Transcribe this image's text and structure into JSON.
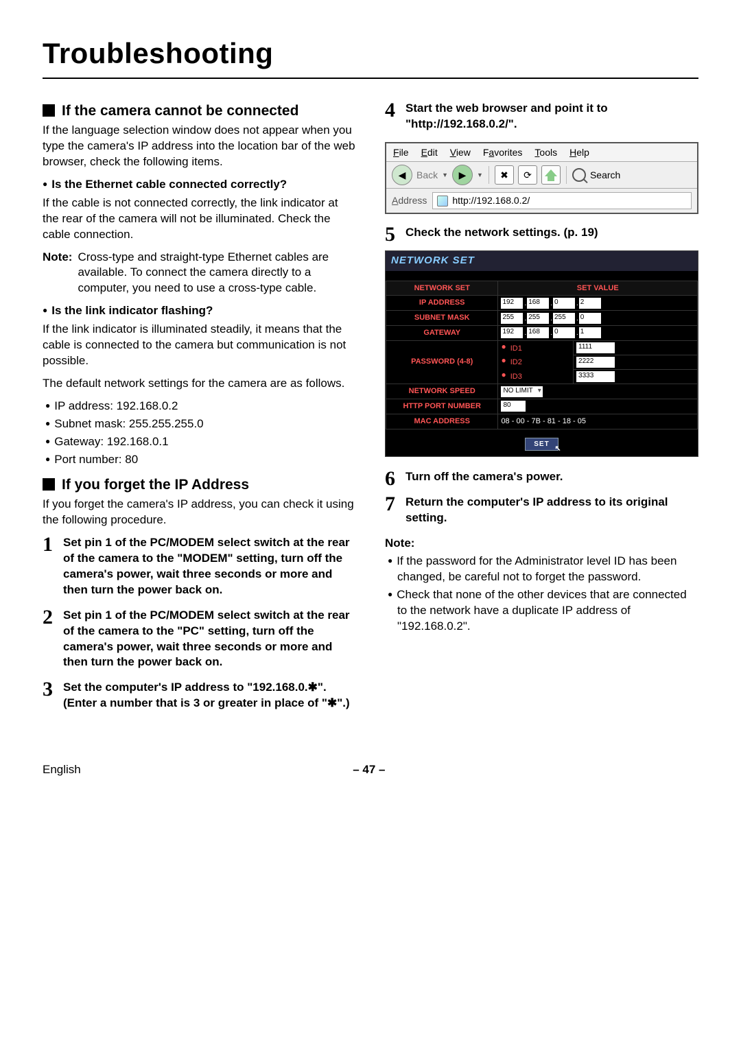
{
  "page_title": "Troubleshooting",
  "left": {
    "sec1_title": "If the camera cannot be connected",
    "sec1_p1": "If the language selection window does not appear when you type the camera's IP address into the location bar of the web browser, check the following items.",
    "sub1": "Is the Ethernet cable connected correctly?",
    "sub1_p": "If the cable is not connected correctly, the link indicator at the rear of the camera will not be illuminated. Check the cable connection.",
    "note1_lbl": "Note:",
    "note1_body": "Cross-type and straight-type Ethernet cables are available. To connect the camera directly to a computer, you need to use a cross-type cable.",
    "sub2": "Is the link indicator flashing?",
    "sub2_p1": "If the link indicator is illuminated steadily, it means that the cable is connected to the camera but communication is not possible.",
    "sub2_p2": "The default network settings for the camera are as follows.",
    "defaults": [
      "IP address: 192.168.0.2",
      "Subnet mask: 255.255.255.0",
      "Gateway: 192.168.0.1",
      "Port number: 80"
    ],
    "sec2_title": "If you forget the IP Address",
    "sec2_p1": "If you forget the camera's IP address, you can check it using the following procedure.",
    "step1": "Set pin 1 of the PC/MODEM select switch at the rear of the camera to the \"MODEM\" setting, turn off the camera's power, wait three seconds or more and then turn the power back on.",
    "step2": "Set pin 1 of the PC/MODEM select switch at the rear of the camera to the \"PC\" setting, turn off the camera's power, wait three seconds or more and then turn the power back on.",
    "step3": "Set the computer's IP address to \"192.168.0.✱\". (Enter a number that is 3 or greater in place of \"✱\".)"
  },
  "right": {
    "step4": "Start the web browser and point it to \"http://192.168.0.2/\".",
    "step5": "Check the network settings. (p. 19)",
    "step6": "Turn off the camera's power.",
    "step7": "Return the computer's IP address to its original setting.",
    "note_lbl": "Note:",
    "notes": [
      "If the password for the Administrator level ID has been changed, be careful not to forget the password.",
      "Check that none of the other devices that are connected to the network have a duplicate IP address of \"192.168.0.2\"."
    ]
  },
  "browser": {
    "menus": {
      "file": "File",
      "edit": "Edit",
      "view": "View",
      "fav": "Favorites",
      "tools": "Tools",
      "help": "Help"
    },
    "back": "Back",
    "search": "Search",
    "addr_lbl": "Address",
    "addr_val": "http://192.168.0.2/"
  },
  "netset": {
    "title": "NETWORK SET",
    "h1": "NETWORK SET",
    "h2": "SET VALUE",
    "rows": {
      "ip": "IP ADDRESS",
      "ip_v": [
        "192",
        "168",
        "0",
        "2"
      ],
      "sm": "SUBNET MASK",
      "sm_v": [
        "255",
        "255",
        "255",
        "0"
      ],
      "gw": "GATEWAY",
      "gw_v": [
        "192",
        "168",
        "0",
        "1"
      ],
      "pw": "PASSWORD (4-8)",
      "id1": "ID1",
      "id1_v": "1111",
      "id2": "ID2",
      "id2_v": "2222",
      "id3": "ID3",
      "id3_v": "3333",
      "ns": "NETWORK SPEED",
      "ns_v": "NO LIMIT",
      "port": "HTTP PORT NUMBER",
      "port_v": "80",
      "mac": "MAC ADDRESS",
      "mac_v": "08 - 00 - 7B - 81 - 18 - 05"
    },
    "set_btn": "SET"
  },
  "footer": {
    "lang": "English",
    "page": "– 47 –"
  }
}
